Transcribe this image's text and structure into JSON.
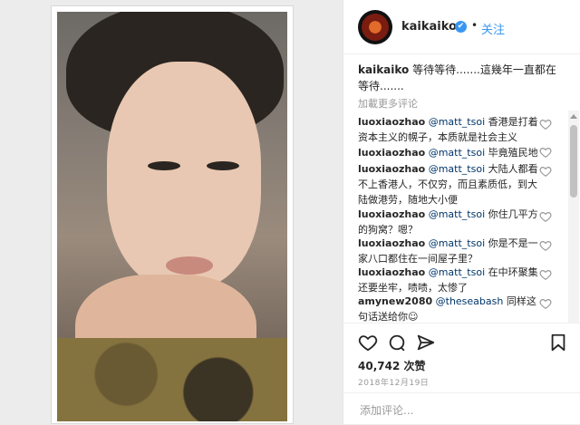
{
  "post": {
    "username": "kaikaiko",
    "follow_label": "关注",
    "dot": "•",
    "verified_mark": "✔",
    "caption_user": "kaikaiko",
    "caption_text": "等待等待.......這幾年一直都在等待.......",
    "load_more": "加載更多评论"
  },
  "comments": [
    {
      "user": "luoxiaozhao",
      "mention": "@matt_tsoi",
      "text": "香港是打着资本主义的幌子，本质就是社会主义"
    },
    {
      "user": "luoxiaozhao",
      "mention": "@matt_tsoi",
      "text": "毕竟殖民地"
    },
    {
      "user": "luoxiaozhao",
      "mention": "@matt_tsoi",
      "text": "大陆人都看不上香港人，不仅穷，而且素质低，到大陆做港劳，随地大小便"
    },
    {
      "user": "luoxiaozhao",
      "mention": "@matt_tsoi",
      "text": "你住几平方的狗窝？嗯？"
    },
    {
      "user": "luoxiaozhao",
      "mention": "@matt_tsoi",
      "text": "你是不是一家八口都住在一间屋子里？"
    },
    {
      "user": "luoxiaozhao",
      "mention": "@matt_tsoi",
      "text": "在中环聚集还要坐牢，啧啧，太惨了"
    },
    {
      "user": "amynew2080",
      "mention": "@theseabash",
      "text": "同样这句话送给你☺"
    }
  ],
  "footer": {
    "likes": "40,742 次赞",
    "date": "2018年12月19日",
    "add_comment_placeholder": "添加评论..."
  },
  "icons": {
    "like": "heart-icon",
    "comment": "comment-icon",
    "share": "share-icon",
    "save": "bookmark-icon"
  },
  "colors": {
    "link": "#3897f0",
    "mention": "#003569",
    "muted": "#999999"
  }
}
